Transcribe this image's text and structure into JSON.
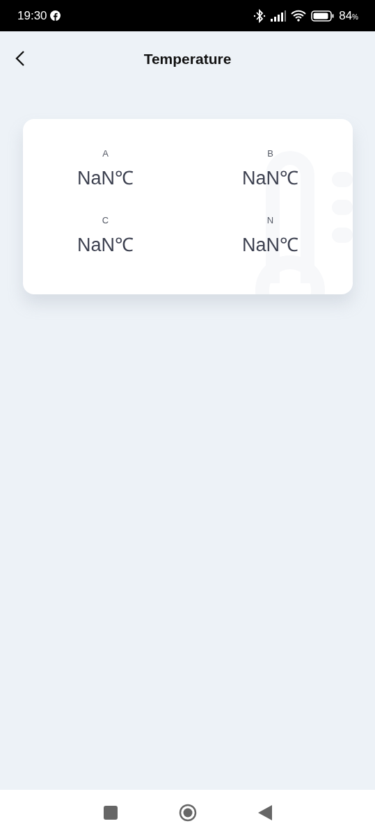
{
  "status_bar": {
    "time": "19:30",
    "battery": "84",
    "battery_unit": "%"
  },
  "header": {
    "title": "Temperature"
  },
  "readings": [
    {
      "label": "A",
      "value": "NaN℃"
    },
    {
      "label": "B",
      "value": "NaN℃"
    },
    {
      "label": "C",
      "value": "NaN℃"
    },
    {
      "label": "N",
      "value": "NaN℃"
    }
  ]
}
